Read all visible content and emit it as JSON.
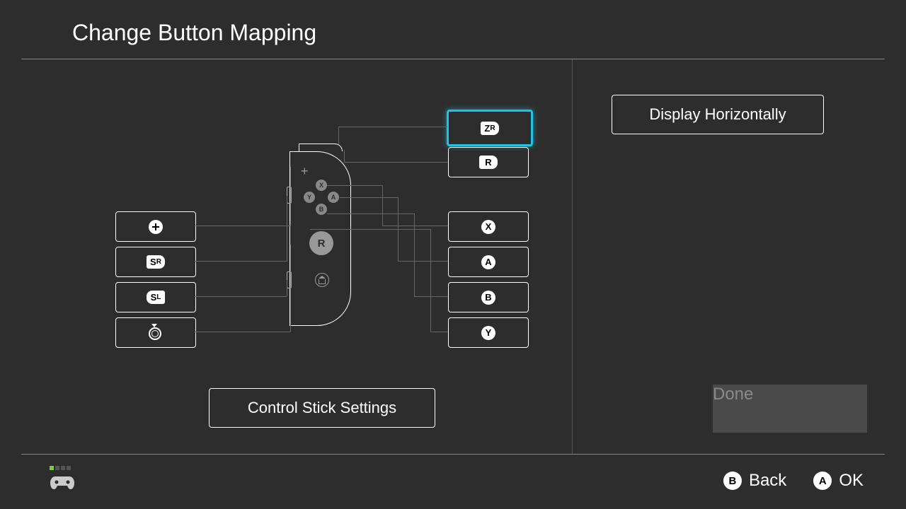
{
  "header": {
    "title": "Change Button Mapping"
  },
  "left_buttons": [
    {
      "key": "plus",
      "label": "+"
    },
    {
      "key": "sr",
      "label": "SR"
    },
    {
      "key": "sl",
      "label": "SL"
    },
    {
      "key": "stick_press",
      "label": "R-stick-press"
    }
  ],
  "right_buttons": [
    {
      "key": "zr",
      "label": "ZR",
      "selected": true
    },
    {
      "key": "r",
      "label": "R"
    },
    {
      "key": "x",
      "label": "X"
    },
    {
      "key": "a",
      "label": "A"
    },
    {
      "key": "b",
      "label": "B"
    },
    {
      "key": "y",
      "label": "Y"
    }
  ],
  "control_stick": {
    "label": "Control Stick Settings"
  },
  "side": {
    "display_horizontal": "Display Horizontally",
    "done": "Done"
  },
  "joycon": {
    "stick_label": "R",
    "face_buttons": {
      "x": "X",
      "y": "Y",
      "a": "A",
      "b": "B"
    }
  },
  "footer": {
    "player_slot_active": 1,
    "back": {
      "btn": "B",
      "label": "Back"
    },
    "ok": {
      "btn": "A",
      "label": "OK"
    }
  }
}
